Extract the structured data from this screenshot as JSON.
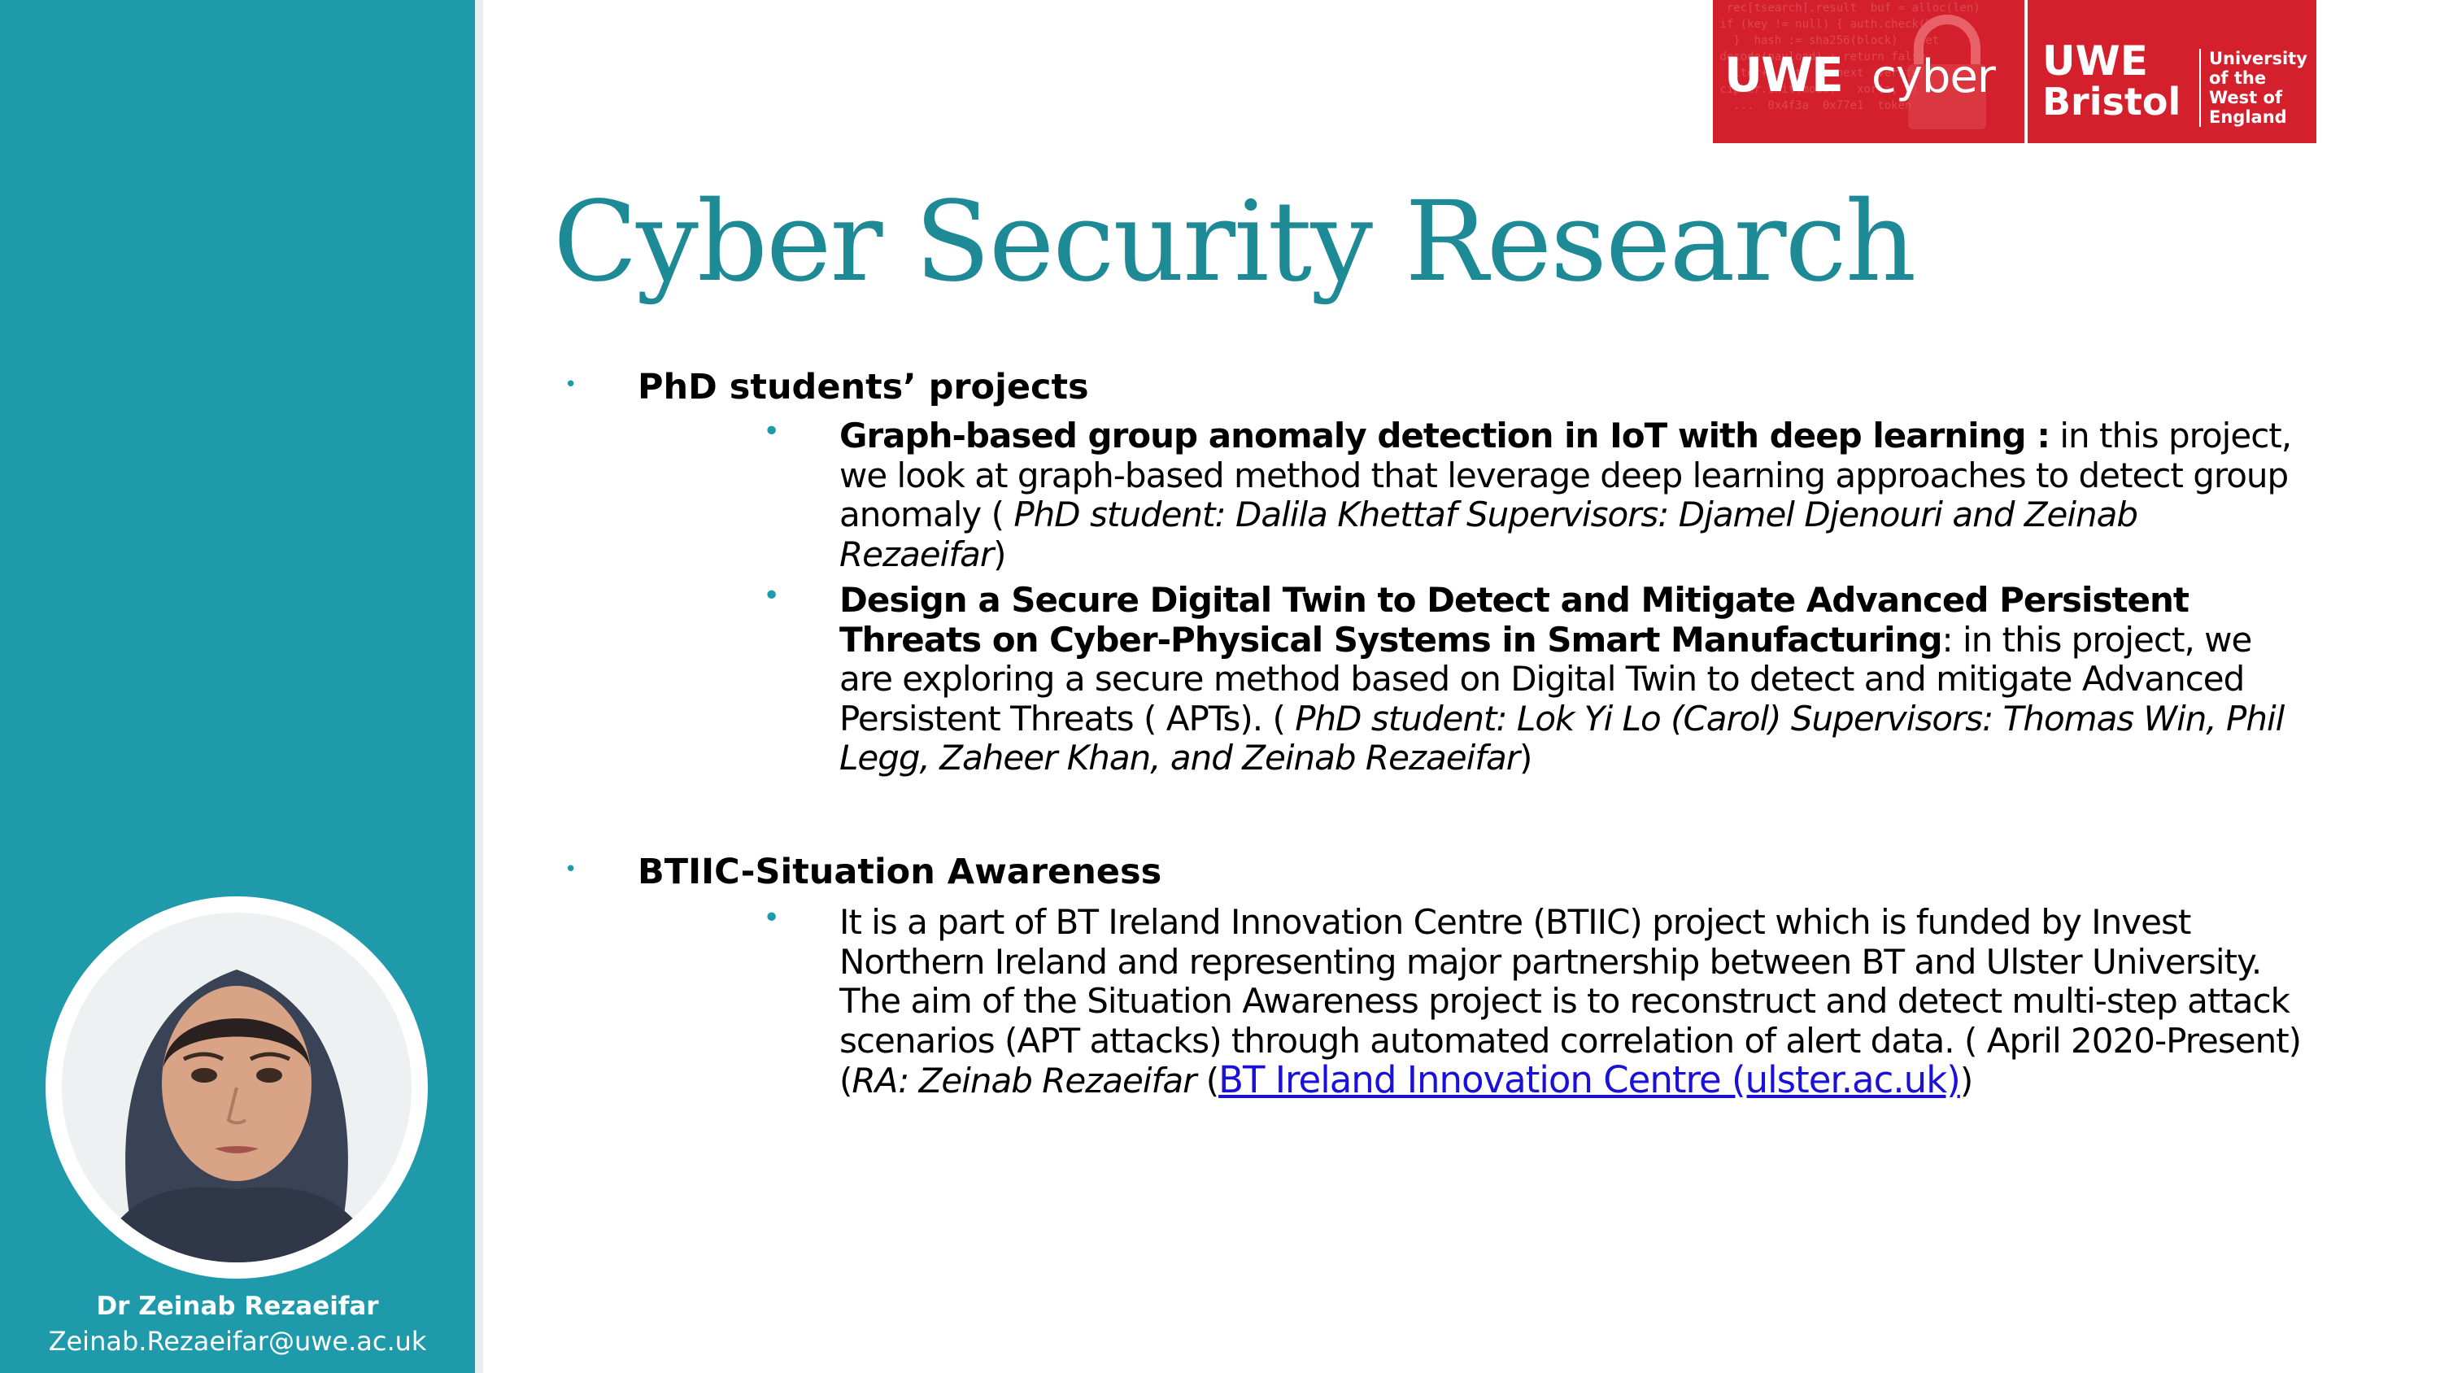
{
  "title": "Cyber Security Research",
  "logo": {
    "uwe": "UWE",
    "cyber": "cyber",
    "uwe2": "UWE",
    "bristol": "Bristol",
    "university": [
      "University",
      "of the",
      "West of",
      "England"
    ]
  },
  "profile": {
    "name": "Dr Zeinab Rezaeifar",
    "email": "Zeinab.Rezaeifar@uwe.ac.uk"
  },
  "sections": [
    {
      "heading": "PhD students’ projects",
      "items": [
        {
          "title": "Graph-based group anomaly detection in IoT with deep learning  :",
          "text": " in this project, we look at graph-based method that leverage deep learning approaches to detect group anomaly ( ",
          "credit": "PhD student: Dalila Khettaf  Supervisors: Djamel Djenouri and Zeinab Rezaeifar",
          "end": ")"
        },
        {
          "title": "Design a Secure Digital Twin to Detect and Mitigate Advanced Persistent Threats on Cyber-Physical Systems in Smart Manufacturing",
          "text": ": in this project, we are exploring a secure method based on Digital Twin to detect and mitigate Advanced Persistent Threats ( APTs). ( ",
          "credit": "PhD student: Lok Yi Lo (Carol) Supervisors: Thomas Win, Phil Legg, Zaheer Khan, and Zeinab Rezaeifar",
          "end": ")"
        }
      ]
    },
    {
      "heading": "BTIIC-Situation Awareness",
      "items": [
        {
          "text": " It is a part of BT Ireland Innovation Centre (BTIIC) project which is funded by Invest Northern Ireland and representing major partnership between BT and Ulster University. The aim of the Situation Awareness project is to reconstruct and detect multi-step attack scenarios (APT attacks) through automated correlation of alert data.  ( April 2020-Present)(",
          "credit": "RA: Zeinab Rezaeifar",
          "open": " (",
          "link": "BT Ireland Innovation Centre (ulster.ac.uk)",
          "end": ")"
        }
      ]
    }
  ]
}
